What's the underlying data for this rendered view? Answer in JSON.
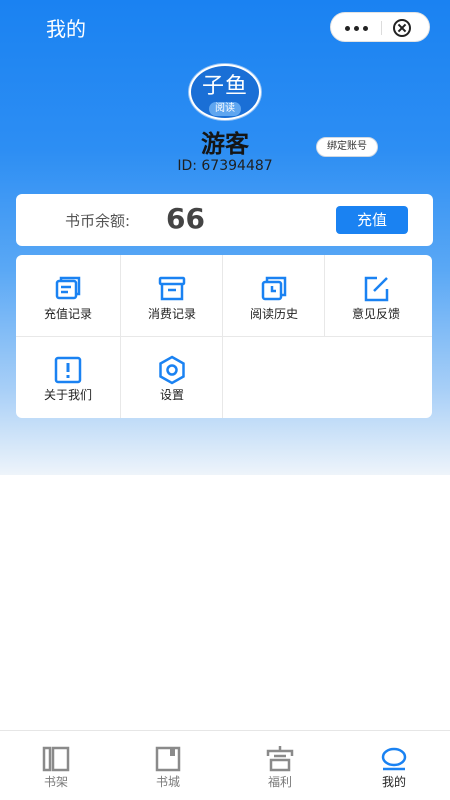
{
  "header": {
    "title": "我的"
  },
  "profile": {
    "avatar_logo_main": "子鱼",
    "avatar_logo_sub": "阅读",
    "name": "游客",
    "bind_label": "绑定账号",
    "id_text": "ID: 67394487"
  },
  "balance": {
    "label": "书币余额:",
    "value": "66",
    "recharge_label": "充值"
  },
  "menu": {
    "items": [
      {
        "label": "充值记录",
        "icon": "recharge-record-icon"
      },
      {
        "label": "消费记录",
        "icon": "consume-record-icon"
      },
      {
        "label": "阅读历史",
        "icon": "reading-history-icon"
      },
      {
        "label": "意见反馈",
        "icon": "feedback-icon"
      },
      {
        "label": "关于我们",
        "icon": "about-us-icon"
      },
      {
        "label": "设置",
        "icon": "settings-icon"
      }
    ]
  },
  "tabbar": {
    "items": [
      {
        "label": "书架",
        "icon": "bookshelf-icon"
      },
      {
        "label": "书城",
        "icon": "bookstore-icon"
      },
      {
        "label": "福利",
        "icon": "welfare-icon"
      },
      {
        "label": "我的",
        "icon": "profile-icon"
      }
    ],
    "active_index": 3
  },
  "colors": {
    "accent": "#1a82f2",
    "inactive_icon": "#8a8a8a"
  }
}
